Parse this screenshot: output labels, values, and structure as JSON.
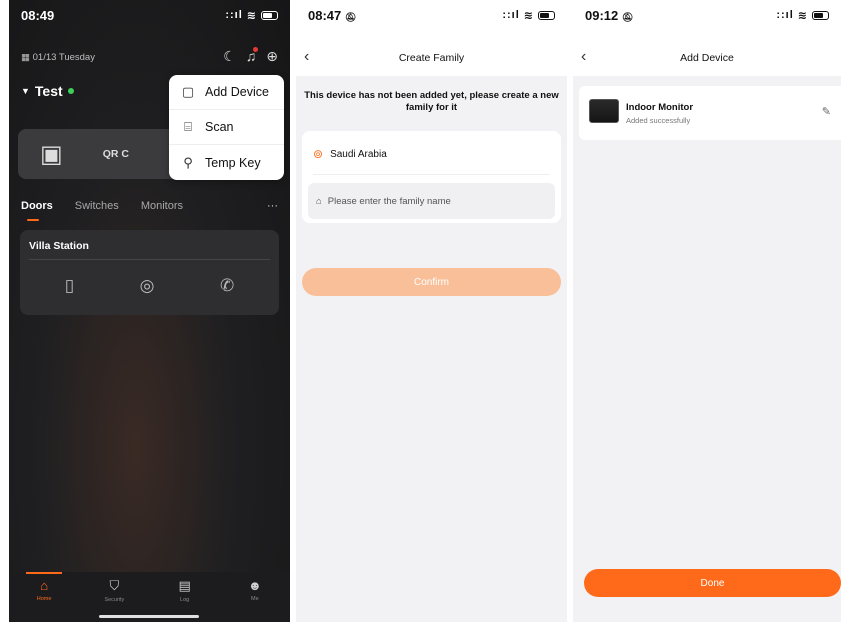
{
  "accent_color": "#ff6a1a",
  "screen1": {
    "status": {
      "time": "08:49",
      "signal": ":ıl"
    },
    "date": "01/13 Tuesday",
    "family_name": "Test",
    "qr_label": "QR C",
    "tabs": [
      "Doors",
      "Switches",
      "Monitors"
    ],
    "more": "···",
    "villa_title": "Villa Station",
    "popup_menu": [
      {
        "label": "Add Device",
        "icon": "add-device-icon"
      },
      {
        "label": "Scan",
        "icon": "scan-icon"
      },
      {
        "label": "Temp Key",
        "icon": "key-icon"
      }
    ],
    "nav": [
      "Home",
      "Security",
      "Log",
      "Me"
    ]
  },
  "screen2": {
    "status": {
      "time": "08:47"
    },
    "title": "Create Family",
    "message": "This device has not been added yet, please create a new family for it",
    "location": "Saudi Arabia",
    "family_placeholder": "Please enter the family name",
    "confirm_label": "Confirm"
  },
  "screen3": {
    "status": {
      "time": "09:12"
    },
    "title": "Add Device",
    "device_name": "Indoor Monitor",
    "device_status": "Added successfully",
    "done_label": "Done"
  }
}
